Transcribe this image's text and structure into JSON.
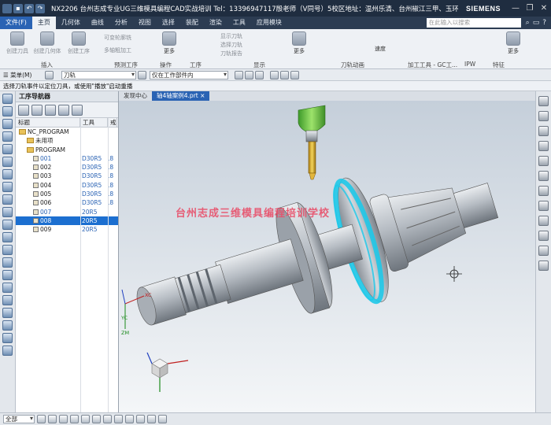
{
  "window": {
    "title": "NX2206 台州志成专业UG三维模具编程CAD实战培训 Tel：13396947117殷老师（V同号）5校区地址：温州乐清、台州椒江三甲、玉环华鸿、玉环沙门、玉环坎门 - 加工",
    "brand": "SIEMENS",
    "min": "—",
    "max": "❐",
    "close": "✕"
  },
  "menu_tabs": [
    {
      "label": "文件(F)"
    },
    {
      "label": "主页"
    },
    {
      "label": "几何体"
    },
    {
      "label": "曲线"
    },
    {
      "label": "分析"
    },
    {
      "label": "视图"
    },
    {
      "label": "选择"
    },
    {
      "label": "装配"
    },
    {
      "label": "渲染"
    },
    {
      "label": "工具"
    },
    {
      "label": "应用模块"
    }
  ],
  "search": {
    "placeholder": "在此输入以搜索"
  },
  "ribbon": {
    "buttons": [
      {
        "label": "创建刀具"
      },
      {
        "label": "创建几何体"
      },
      {
        "label": "创建工序"
      },
      {
        "label": "更多"
      },
      {
        "label": "更多"
      },
      {
        "label": "更多"
      }
    ],
    "small_items": [
      "可变轮廓铣",
      "多轴粗加工",
      "显示刀轨",
      "选择刀轨",
      "刀轨报告",
      "速度"
    ],
    "groups": [
      "插入",
      "预测工序",
      "操作",
      "工序",
      "显示",
      "刀轨动画",
      "加工工具 - GC工...",
      "IPW",
      "特征"
    ]
  },
  "toolbar": {
    "menu_label": "☰ 菜单(M)",
    "filter_value": "刀轨",
    "scope_value": "仅在工作部件内"
  },
  "message": "选择刀轨事件以定位刀具，或使用\"播放\"启动重播",
  "navigator": {
    "title": "工序导航器",
    "columns": [
      "标题",
      "工具",
      "戒"
    ],
    "rows": [
      {
        "name": "NC_PROGRAM",
        "tool": "",
        "extra": "",
        "type": "root"
      },
      {
        "name": "未用项",
        "tool": "",
        "extra": "",
        "type": "folder"
      },
      {
        "name": "PROGRAM",
        "tool": "",
        "extra": "",
        "type": "folder"
      },
      {
        "name": "001",
        "tool": "D30R5",
        "extra": ".8",
        "type": "op-blue"
      },
      {
        "name": "002",
        "tool": "D30R5",
        "extra": ".8",
        "type": "op"
      },
      {
        "name": "003",
        "tool": "D30R5",
        "extra": ".8",
        "type": "op"
      },
      {
        "name": "004",
        "tool": "D30R5",
        "extra": ".8",
        "type": "op"
      },
      {
        "name": "005",
        "tool": "D30R5",
        "extra": ".8",
        "type": "op"
      },
      {
        "name": "006",
        "tool": "D30R5",
        "extra": ".8",
        "type": "op"
      },
      {
        "name": "007",
        "tool": "20R5",
        "extra": "",
        "type": "op-blue"
      },
      {
        "name": "008",
        "tool": "20R5",
        "extra": "",
        "type": "selected"
      },
      {
        "name": "009",
        "tool": "20R5",
        "extra": "",
        "type": "op"
      }
    ]
  },
  "graphics_tabs": [
    {
      "label": "发现中心"
    },
    {
      "label": "轴4轴案例4.prt ×"
    }
  ],
  "watermark": "台州志成三维模具编程培训学校",
  "axis_labels": {
    "xc": "XC",
    "yc": "YC",
    "zm": "ZM"
  },
  "statusbar": {
    "filter_value": "全部"
  },
  "colors": {
    "title_bg": "#1f2d40",
    "accent": "#2a63b4",
    "selection": "#1c6fd0",
    "toolpath": "#1ec8e8",
    "watermark": "#e8506a"
  }
}
